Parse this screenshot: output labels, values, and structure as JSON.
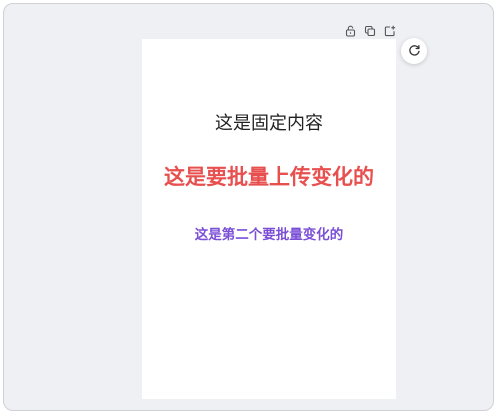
{
  "colors": {
    "fixed_text": "#222222",
    "batch_text_1": "#e8504f",
    "batch_text_2": "#7a4fd6"
  },
  "toolbar": {
    "icons": [
      "lock-icon",
      "copy-icon",
      "add-page-icon"
    ]
  },
  "refresh": {
    "icon": "refresh-icon"
  },
  "poster": {
    "fixed_text": "这是固定内容",
    "batch_text_1": "这是要批量上传变化的",
    "batch_text_2": "这是第二个要批量变化的"
  }
}
